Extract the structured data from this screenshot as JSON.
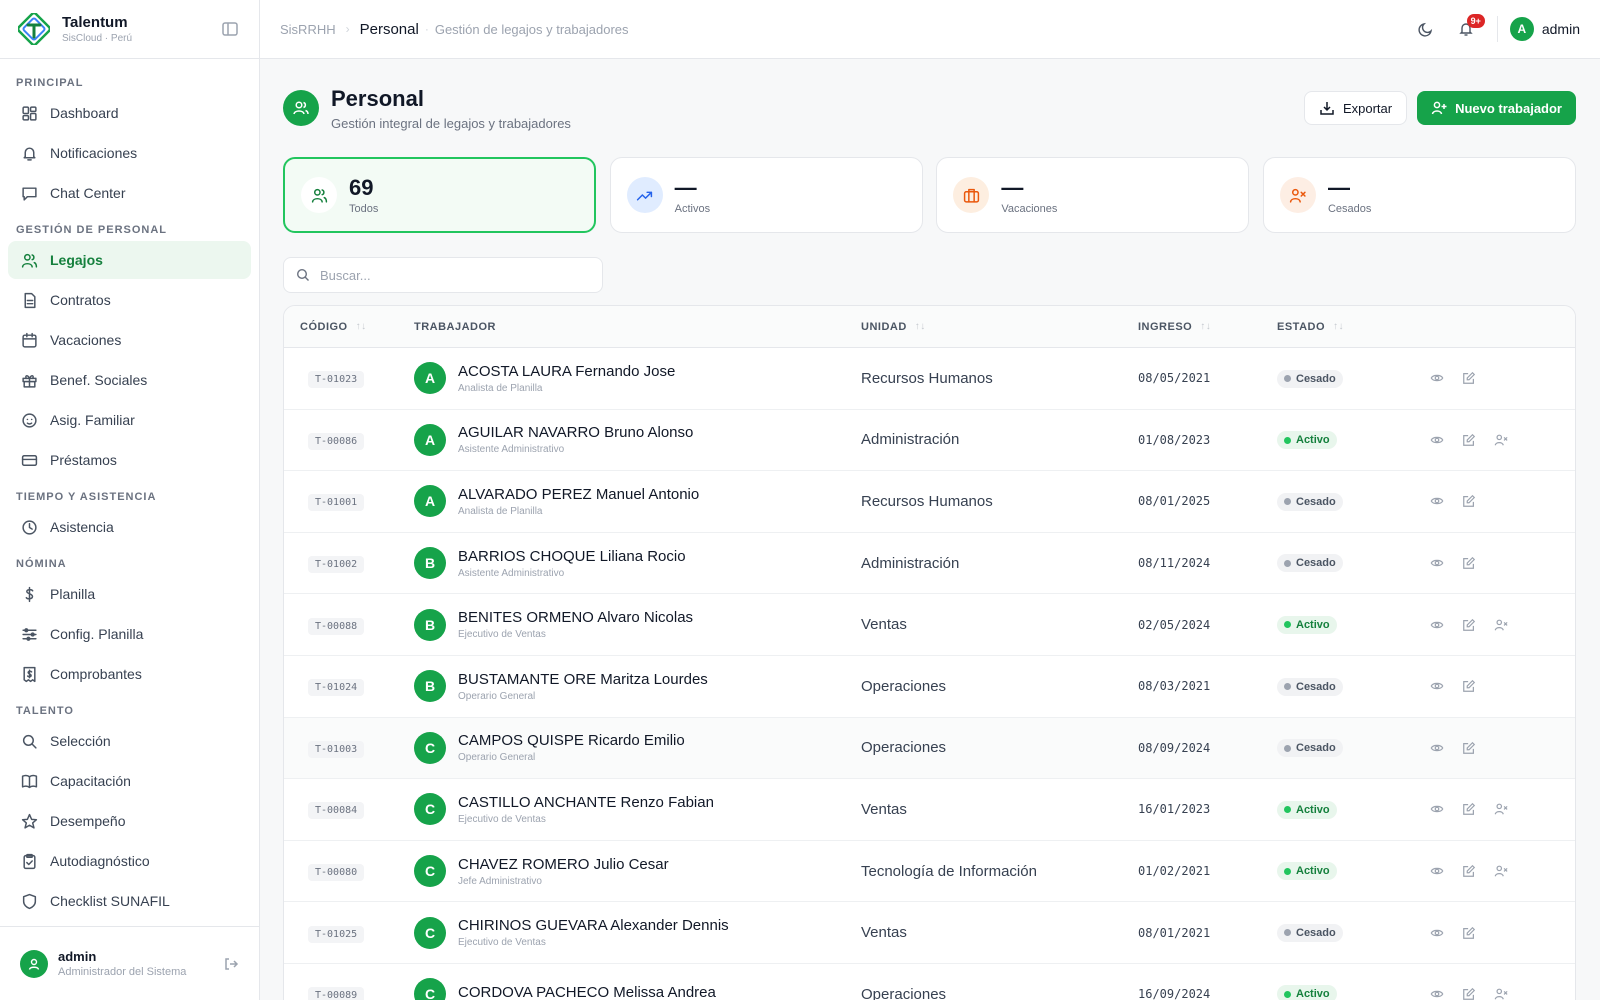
{
  "app": {
    "name": "Talentum",
    "subtitle": "SisCloud · Perú"
  },
  "sidebar": {
    "sections": [
      {
        "title": "PRINCIPAL",
        "items": [
          {
            "label": "Dashboard",
            "icon": "dashboard-icon",
            "active": false
          },
          {
            "label": "Notificaciones",
            "icon": "bell-icon",
            "active": false
          },
          {
            "label": "Chat Center",
            "icon": "chat-icon",
            "active": false
          }
        ]
      },
      {
        "title": "GESTIÓN DE PERSONAL",
        "items": [
          {
            "label": "Legajos",
            "icon": "users-icon",
            "active": true
          },
          {
            "label": "Contratos",
            "icon": "document-icon",
            "active": false
          },
          {
            "label": "Vacaciones",
            "icon": "calendar-icon",
            "active": false
          },
          {
            "label": "Benef. Sociales",
            "icon": "gift-icon",
            "active": false
          },
          {
            "label": "Asig. Familiar",
            "icon": "baby-icon",
            "active": false
          },
          {
            "label": "Préstamos",
            "icon": "credit-card-icon",
            "active": false
          }
        ]
      },
      {
        "title": "TIEMPO Y ASISTENCIA",
        "items": [
          {
            "label": "Asistencia",
            "icon": "clock-icon",
            "active": false
          }
        ]
      },
      {
        "title": "NÓMINA",
        "items": [
          {
            "label": "Planilla",
            "icon": "dollar-icon",
            "active": false
          },
          {
            "label": "Config. Planilla",
            "icon": "sliders-icon",
            "active": false
          },
          {
            "label": "Comprobantes",
            "icon": "receipt-icon",
            "active": false
          }
        ]
      },
      {
        "title": "TALENTO",
        "items": [
          {
            "label": "Selección",
            "icon": "search-icon",
            "active": false
          },
          {
            "label": "Capacitación",
            "icon": "book-icon",
            "active": false
          },
          {
            "label": "Desempeño",
            "icon": "star-icon",
            "active": false
          },
          {
            "label": "Autodiagnóstico",
            "icon": "clipboard-check-icon",
            "active": false
          },
          {
            "label": "Checklist SUNAFIL",
            "icon": "shield-icon",
            "active": false
          }
        ]
      }
    ],
    "user": {
      "name": "admin",
      "role": "Administrador del Sistema"
    }
  },
  "header": {
    "breadcrumb_root": "SisRRHH",
    "breadcrumb_current": "Personal",
    "breadcrumb_desc": "Gestión de legajos y trabajadores",
    "notifications_badge": "9+",
    "user_initial": "A",
    "user_name": "admin"
  },
  "page": {
    "title": "Personal",
    "subtitle": "Gestión integral de legajos y trabajadores",
    "export_label": "Exportar",
    "new_label": "Nuevo trabajador"
  },
  "stats": [
    {
      "value": "69",
      "label": "Todos",
      "icon": "users-icon",
      "active": true,
      "bg": "#ffffff",
      "fg": "#15803d"
    },
    {
      "value": "—",
      "label": "Activos",
      "icon": "trending-up-icon",
      "active": false,
      "bg": "#e0ecff",
      "fg": "#2563eb"
    },
    {
      "value": "—",
      "label": "Vacaciones",
      "icon": "briefcase-icon",
      "active": false,
      "bg": "#fdeee0",
      "fg": "#ea580c"
    },
    {
      "value": "—",
      "label": "Cesados",
      "icon": "user-x-icon",
      "active": false,
      "bg": "#fdeee4",
      "fg": "#ea580c"
    }
  ],
  "search": {
    "placeholder": "Buscar..."
  },
  "table": {
    "headers": {
      "code": "CÓDIGO",
      "worker": "TRABAJADOR",
      "unit": "UNIDAD",
      "date": "INGRESO",
      "status": "ESTADO"
    },
    "rows": [
      {
        "code": "T-01023",
        "initial": "A",
        "name": "ACOSTA LAURA Fernando Jose",
        "role": "Analista de Planilla",
        "unit": "Recursos Humanos",
        "date": "08/05/2021",
        "status": "Cesado"
      },
      {
        "code": "T-00086",
        "initial": "A",
        "name": "AGUILAR NAVARRO Bruno Alonso",
        "role": "Asistente Administrativo",
        "unit": "Administración",
        "date": "01/08/2023",
        "status": "Activo"
      },
      {
        "code": "T-01001",
        "initial": "A",
        "name": "ALVARADO PEREZ Manuel Antonio",
        "role": "Analista de Planilla",
        "unit": "Recursos Humanos",
        "date": "08/01/2025",
        "status": "Cesado"
      },
      {
        "code": "T-01002",
        "initial": "B",
        "name": "BARRIOS CHOQUE Liliana Rocio",
        "role": "Asistente Administrativo",
        "unit": "Administración",
        "date": "08/11/2024",
        "status": "Cesado"
      },
      {
        "code": "T-00088",
        "initial": "B",
        "name": "BENITES ORMENO Alvaro Nicolas",
        "role": "Ejecutivo de Ventas",
        "unit": "Ventas",
        "date": "02/05/2024",
        "status": "Activo"
      },
      {
        "code": "T-01024",
        "initial": "B",
        "name": "BUSTAMANTE ORE Maritza Lourdes",
        "role": "Operario General",
        "unit": "Operaciones",
        "date": "08/03/2021",
        "status": "Cesado"
      },
      {
        "code": "T-01003",
        "initial": "C",
        "name": "CAMPOS QUISPE Ricardo Emilio",
        "role": "Operario General",
        "unit": "Operaciones",
        "date": "08/09/2024",
        "status": "Cesado"
      },
      {
        "code": "T-00084",
        "initial": "C",
        "name": "CASTILLO ANCHANTE Renzo Fabian",
        "role": "Ejecutivo de Ventas",
        "unit": "Ventas",
        "date": "16/01/2023",
        "status": "Activo"
      },
      {
        "code": "T-00080",
        "initial": "C",
        "name": "CHAVEZ ROMERO Julio Cesar",
        "role": "Jefe Administrativo",
        "unit": "Tecnología de Información",
        "date": "01/02/2021",
        "status": "Activo"
      },
      {
        "code": "T-01025",
        "initial": "C",
        "name": "CHIRINOS GUEVARA Alexander Dennis",
        "role": "Ejecutivo de Ventas",
        "unit": "Ventas",
        "date": "08/01/2021",
        "status": "Cesado"
      },
      {
        "code": "T-00089",
        "initial": "C",
        "name": "CORDOVA PACHECO Melissa Andrea",
        "role": "",
        "unit": "Operaciones",
        "date": "16/09/2024",
        "status": "Activo"
      }
    ]
  }
}
